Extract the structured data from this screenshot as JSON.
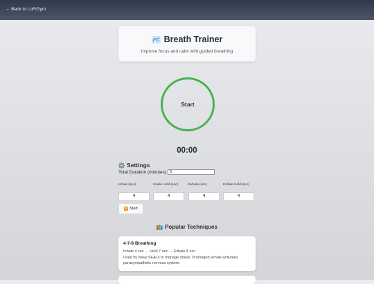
{
  "nav": {
    "back_label": "← Back to LoFiGym"
  },
  "header": {
    "title": "Breath Trainer",
    "subtitle": "Improve focus and calm with guided breathing"
  },
  "breathing_circle": {
    "label": "Start"
  },
  "timer": {
    "value": "00:00"
  },
  "settings": {
    "title": "Settings",
    "duration_label": "Total Duration (minutes)",
    "duration_value": "5",
    "fields": [
      {
        "label": "Inhale (sec)",
        "value": "4"
      },
      {
        "label": "Inhale Hold (sec)",
        "value": "4"
      },
      {
        "label": "Exhale (sec)",
        "value": "4"
      },
      {
        "label": "Exhale Hold (sec)",
        "value": "4"
      }
    ],
    "start_label": "Start"
  },
  "popular": {
    "title": "Popular Techniques",
    "techniques": [
      {
        "name": "4-7-8 Breathing",
        "steps": "Inhale 4 sec → Hold 7 sec → Exhale 8 sec",
        "description": "Used by Navy SEALs to manage stress. Prolonged exhale activates parasympathetic nervous system."
      }
    ]
  },
  "colors": {
    "accent_green": "#4caf50",
    "topbar": "#3a4556",
    "play_orange": "#f39c12"
  },
  "icons": {
    "title_icon": "lungs-icon",
    "settings_icon": "gear-icon",
    "start_icon": "play-icon",
    "popular_icon": "books-icon"
  }
}
